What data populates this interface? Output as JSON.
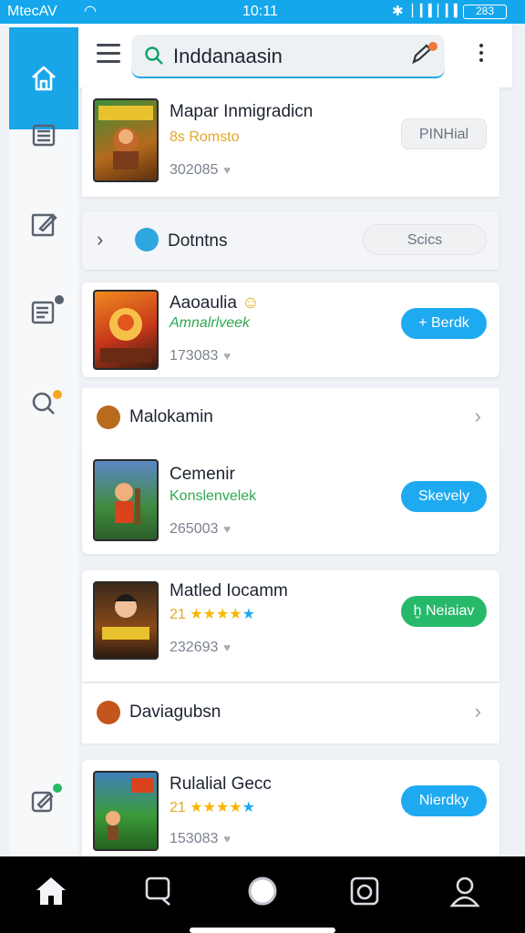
{
  "status_bar": {
    "carrier": "MtecAV",
    "time": "10:11",
    "battery": "283"
  },
  "search": {
    "query": "Inddanaasin"
  },
  "cards": [
    {
      "title": "Mapar Inmigradicn",
      "subtitle": "8s Romsto",
      "count": "302085",
      "button": "PINHial"
    },
    {
      "title": "Aaoaulia",
      "subtitle": "Amnalrlveek",
      "count": "173083",
      "button": "+ Berdk"
    },
    {
      "title": "Cemenir",
      "subtitle": "Konslenvelek",
      "count": "265003",
      "button": "Skevely"
    },
    {
      "title": "Matled Iocamm",
      "rating": "21",
      "count": "232693",
      "button": "ḫ Neiaiav"
    },
    {
      "title": "Rulalial Gecc",
      "rating": "21",
      "count": "153083",
      "button": "Nierdky"
    }
  ],
  "sections": [
    {
      "label": "Dotntns",
      "button": "Scics"
    },
    {
      "label": "Malokamin"
    },
    {
      "label": "Daviagubsn"
    }
  ],
  "colors": {
    "accent": "#19a6e9",
    "status_bar": "#14a7ec",
    "green": "#27b96a",
    "star": "#f7b500"
  },
  "icons": {
    "rail": [
      "home-icon",
      "list-icon",
      "edit-icon",
      "notes-icon",
      "search-badge-icon",
      "compose-icon"
    ],
    "bottom_nav": [
      "home-icon",
      "chat-icon",
      "circle-icon",
      "camera-icon",
      "person-icon"
    ]
  }
}
